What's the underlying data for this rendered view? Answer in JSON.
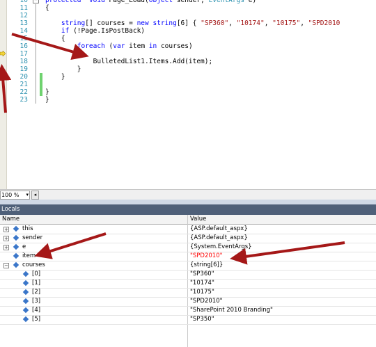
{
  "editor": {
    "lines": [
      {
        "n": "10",
        "fold": "minus",
        "changed": false,
        "parts": [
          [
            "kw",
            "protected"
          ],
          [
            "",
            "  "
          ],
          [
            "kw",
            "void"
          ],
          [
            "",
            " Page_Load("
          ],
          [
            "kw",
            "object"
          ],
          [
            "",
            " sender, "
          ],
          [
            "ty",
            "EventArgs"
          ],
          [
            "",
            " e)"
          ]
        ]
      },
      {
        "n": "11",
        "fold": "",
        "changed": false,
        "parts": [
          [
            "",
            "{"
          ]
        ]
      },
      {
        "n": "12",
        "fold": "",
        "changed": false,
        "parts": [
          [
            "",
            ""
          ]
        ]
      },
      {
        "n": "13",
        "fold": "",
        "changed": false,
        "parts": [
          [
            "",
            "    "
          ],
          [
            "kw",
            "string"
          ],
          [
            "",
            "[] courses = "
          ],
          [
            "kw",
            "new"
          ],
          [
            "",
            " "
          ],
          [
            "kw",
            "string"
          ],
          [
            "",
            "[6] { "
          ],
          [
            "str",
            "\"SP360\""
          ],
          [
            "",
            ", "
          ],
          [
            "str",
            "\"10174\""
          ],
          [
            "",
            ", "
          ],
          [
            "str",
            "\"10175\""
          ],
          [
            "",
            ", "
          ],
          [
            "str",
            "\"SPD2010"
          ]
        ]
      },
      {
        "n": "14",
        "fold": "",
        "changed": false,
        "parts": [
          [
            "",
            "    "
          ],
          [
            "kw",
            "if"
          ],
          [
            "",
            " (!Page.IsPostBack)"
          ]
        ]
      },
      {
        "n": "15",
        "fold": "",
        "changed": false,
        "parts": [
          [
            "",
            "    {"
          ]
        ]
      },
      {
        "n": "16",
        "fold": "",
        "changed": false,
        "parts": [
          [
            "",
            "        "
          ],
          [
            "kw",
            "foreach"
          ],
          [
            "",
            " ("
          ],
          [
            "kw",
            "var"
          ],
          [
            "",
            " item "
          ],
          [
            "kw",
            "in"
          ],
          [
            "",
            " courses)"
          ]
        ]
      },
      {
        "n": "17",
        "fold": "",
        "changed": false,
        "parts": [
          [
            "",
            "        "
          ],
          [
            "hl",
            "{"
          ]
        ]
      },
      {
        "n": "18",
        "fold": "",
        "changed": false,
        "parts": [
          [
            "",
            "            BulletedList1.Items.Add(item);"
          ]
        ]
      },
      {
        "n": "19",
        "fold": "",
        "changed": false,
        "parts": [
          [
            "",
            "        }"
          ]
        ]
      },
      {
        "n": "20",
        "fold": "",
        "changed": true,
        "parts": [
          [
            "",
            "    }"
          ]
        ]
      },
      {
        "n": "21",
        "fold": "",
        "changed": true,
        "parts": [
          [
            "",
            ""
          ]
        ]
      },
      {
        "n": "22",
        "fold": "",
        "changed": true,
        "parts": [
          [
            "",
            "}"
          ]
        ]
      },
      {
        "n": "23",
        "fold": "",
        "changed": false,
        "parts": [
          [
            "",
            "}"
          ]
        ]
      }
    ]
  },
  "toolbar": {
    "zoom": "100 %"
  },
  "locals": {
    "title": "Locals",
    "headers": {
      "name": "Name",
      "value": "Value"
    },
    "rows": [
      {
        "name": "this",
        "value": "{ASP.default_aspx}",
        "expander": "+",
        "depth": 0,
        "changed": false
      },
      {
        "name": "sender",
        "value": "{ASP.default_aspx}",
        "expander": "+",
        "depth": 0,
        "changed": false
      },
      {
        "name": "e",
        "value": "{System.EventArgs}",
        "expander": "+",
        "depth": 0,
        "changed": false
      },
      {
        "name": "item",
        "value": "\"SPD2010\"",
        "expander": "",
        "depth": 0,
        "changed": true
      },
      {
        "name": "courses",
        "value": "{string[6]}",
        "expander": "-",
        "depth": 0,
        "changed": false
      },
      {
        "name": "[0]",
        "value": "\"SP360\"",
        "expander": "",
        "depth": 1,
        "changed": false
      },
      {
        "name": "[1]",
        "value": "\"10174\"",
        "expander": "",
        "depth": 1,
        "changed": false
      },
      {
        "name": "[2]",
        "value": "\"10175\"",
        "expander": "",
        "depth": 1,
        "changed": false
      },
      {
        "name": "[3]",
        "value": "\"SPD2010\"",
        "expander": "",
        "depth": 1,
        "changed": false
      },
      {
        "name": "[4]",
        "value": "\"SharePoint 2010 Branding\"",
        "expander": "",
        "depth": 1,
        "changed": false
      },
      {
        "name": "[5]",
        "value": "\"SP350\"",
        "expander": "",
        "depth": 1,
        "changed": false
      }
    ]
  },
  "colors": {
    "keyword": "#0000ff",
    "string": "#a31515",
    "type": "#2b91af",
    "annotation_arrow": "#a51818",
    "locals_title_bg": "#4f6079",
    "changed_value": "#ff0000"
  }
}
